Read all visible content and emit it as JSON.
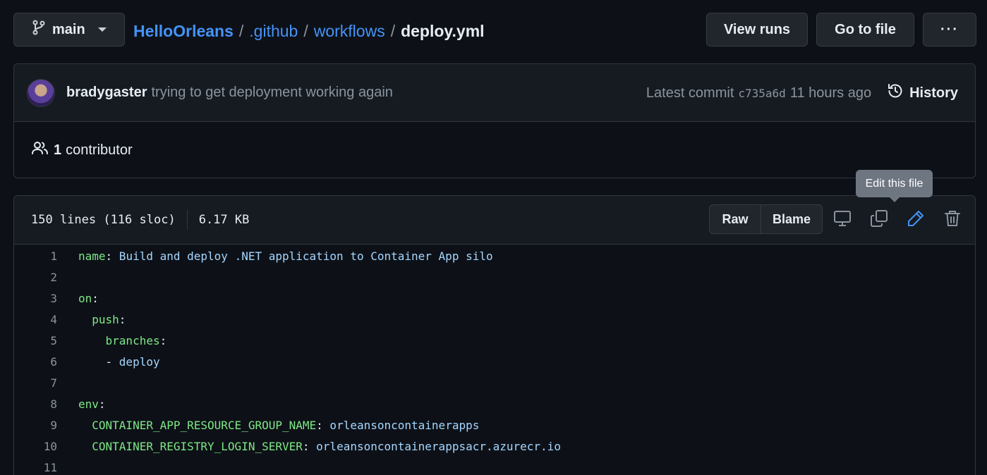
{
  "branch": {
    "name": "main",
    "icon": "git-branch-icon"
  },
  "breadcrumb": {
    "repo": "HelloOrleans",
    "sep": "/",
    "folders": [
      ".github",
      "workflows"
    ],
    "file": "deploy.yml"
  },
  "top_actions": {
    "view_runs": "View runs",
    "go_to_file": "Go to file",
    "more": "···"
  },
  "commit": {
    "author": "bradygaster",
    "message": "trying to get deployment working again",
    "latest_label": "Latest commit",
    "sha": "c735a6d",
    "time": "11 hours ago",
    "history_label": "History"
  },
  "contributors": {
    "count": "1",
    "label": "contributor"
  },
  "file_info": {
    "lines": "150 lines (116 sloc)",
    "size": "6.17 KB"
  },
  "file_actions": {
    "raw": "Raw",
    "blame": "Blame",
    "tooltip": "Edit this file"
  },
  "code_lines": [
    {
      "n": "1",
      "key": "name",
      "colon": ":",
      "value": " Build and deploy .NET application to Container App silo",
      "indent": ""
    },
    {
      "n": "2",
      "key": "",
      "colon": "",
      "value": "",
      "indent": ""
    },
    {
      "n": "3",
      "key": "on",
      "colon": ":",
      "value": "",
      "indent": ""
    },
    {
      "n": "4",
      "key": "push",
      "colon": ":",
      "value": "",
      "indent": "  "
    },
    {
      "n": "5",
      "key": "branches",
      "colon": ":",
      "value": "",
      "indent": "    "
    },
    {
      "n": "6",
      "key": "",
      "colon": "- ",
      "value": "deploy",
      "indent": "    "
    },
    {
      "n": "7",
      "key": "",
      "colon": "",
      "value": "",
      "indent": ""
    },
    {
      "n": "8",
      "key": "env",
      "colon": ":",
      "value": "",
      "indent": ""
    },
    {
      "n": "9",
      "key": "CONTAINER_APP_RESOURCE_GROUP_NAME",
      "colon": ":",
      "value": " orleansoncontainerapps",
      "indent": "  "
    },
    {
      "n": "10",
      "key": "CONTAINER_REGISTRY_LOGIN_SERVER",
      "colon": ":",
      "value": " orleansoncontainerappsacr.azurecr.io",
      "indent": "  "
    },
    {
      "n": "11",
      "key": "",
      "colon": "",
      "value": "",
      "indent": ""
    }
  ],
  "colors": {
    "link": "#4493f8",
    "key": "#7ee787",
    "string": "#a5d6ff",
    "edit_icon": "#4493f8"
  }
}
